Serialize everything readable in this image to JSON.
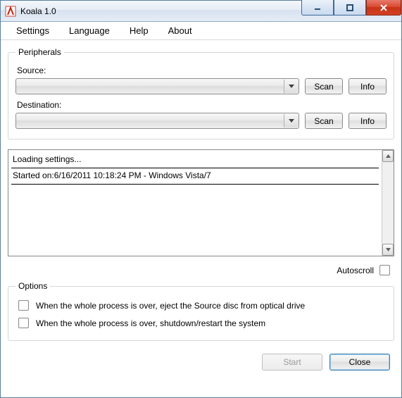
{
  "title": "Koala 1.0",
  "menu": {
    "settings": "Settings",
    "language": "Language",
    "help": "Help",
    "about": "About"
  },
  "peripherals": {
    "legend": "Peripherals",
    "source_label": "Source:",
    "destination_label": "Destination:",
    "source_value": "",
    "destination_value": "",
    "scan": "Scan",
    "info": "Info"
  },
  "log": {
    "lines": [
      "Loading settings...",
      "Started on:6/16/2011 10:18:24 PM - Windows Vista/7"
    ]
  },
  "autoscroll_label": "Autoscroll",
  "options": {
    "legend": "Options",
    "eject_label": "When the whole process is over, eject the Source disc from optical drive",
    "shutdown_label": "When the whole process is over, shutdown/restart the system"
  },
  "footer": {
    "start": "Start",
    "close": "Close"
  }
}
